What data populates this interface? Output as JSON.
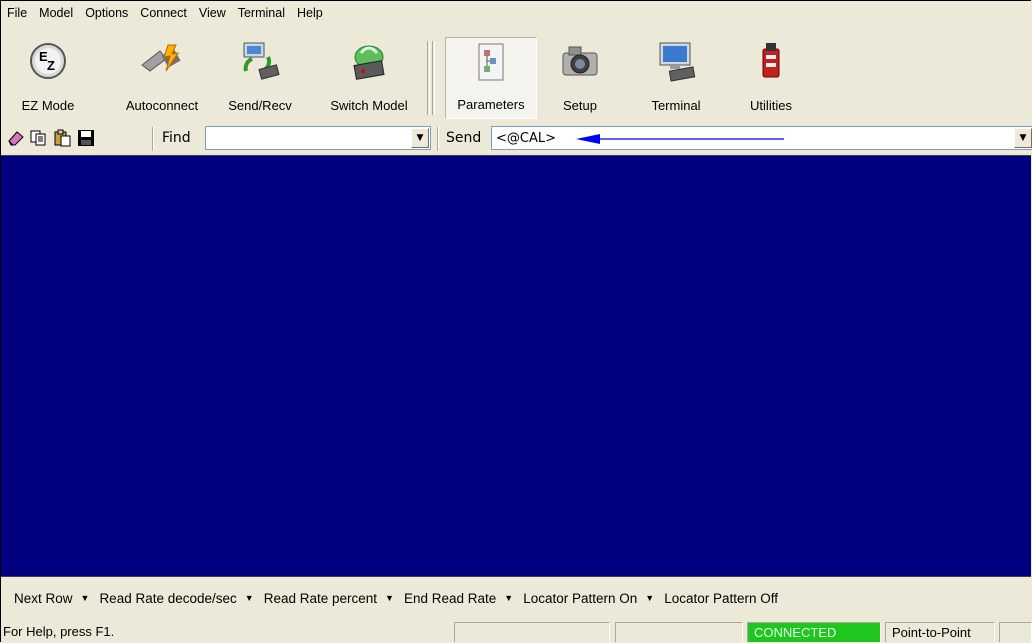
{
  "menu": [
    "File",
    "Model",
    "Options",
    "Connect",
    "View",
    "Terminal",
    "Help"
  ],
  "toolbar": {
    "ez_mode": "EZ Mode",
    "autoconnect": "Autoconnect",
    "send_recv": "Send/Recv",
    "switch_model": "Switch Model",
    "parameters": "Parameters",
    "setup": "Setup",
    "terminal": "Terminal",
    "utilities": "Utilities"
  },
  "smallbar": {
    "find_label": "Find",
    "find_value": "",
    "send_label": "Send",
    "send_value": "<@CAL>"
  },
  "macros": [
    "Next Row",
    "Read Rate decode/sec",
    "Read Rate percent",
    "End Read Rate",
    "Locator Pattern On",
    "Locator Pattern Off"
  ],
  "status": {
    "help": "For Help, press F1.",
    "connection": "CONNECTED",
    "mode": "Point-to-Point"
  },
  "colors": {
    "terminal_bg": "#000080",
    "connected_bg": "#1ec61e",
    "arrow": "#0000ff"
  }
}
